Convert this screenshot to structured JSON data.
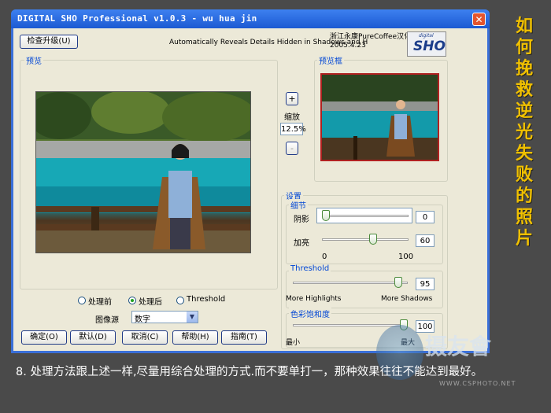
{
  "window": {
    "title": "DIGITAL SHO Professional  v1.0.3 - wu hua jin",
    "close_glyph": "✕",
    "subtitle": "Automatically Reveals Details Hidden in Shadows and H",
    "credit_line1": "浙江永康PureCoffee汉化",
    "credit_line2": "2005.4.23",
    "logo_small": "digital",
    "logo_big": "SHO"
  },
  "buttons": {
    "check_upgrade": "检查升级(U)",
    "zoom_in": "+",
    "zoom_out": "-",
    "ok": "确定(O)",
    "default": "默认(D)",
    "cancel": "取消(C)",
    "help": "帮助(H)",
    "guide": "指南(T)"
  },
  "preview": {
    "label": "预览",
    "zoom_label": "缩放",
    "zoom_value": "12.5%",
    "frame_label": "预览框"
  },
  "view_options": {
    "before": "处理前",
    "after": "处理后",
    "threshold": "Threshold",
    "selected": "after",
    "source_label": "图像源",
    "source_value": "数字"
  },
  "settings": {
    "label": "设置",
    "detail": {
      "label": "细节",
      "shadow_label": "阴影",
      "shadow_value": "0",
      "highlight_label": "加亮",
      "highlight_value": "60",
      "min_label": "0",
      "max_label": "100"
    },
    "threshold": {
      "label": "Threshold",
      "value": "95",
      "left_label": "More Highlights",
      "right_label": "More Shadows"
    },
    "saturation": {
      "label": "色彩饱和度",
      "value": "100",
      "min_label": "最小",
      "max_label": "最大"
    }
  },
  "side_title": [
    "如",
    "何",
    "挽",
    "救",
    "逆",
    "光",
    "失",
    "败",
    "的",
    "照",
    "片"
  ],
  "caption": "8. 处理方法跟上述一样,尽量用综合处理的方式.而不要单打一，那种效果往往不能达到最好。",
  "watermark": {
    "cn": "摄友會",
    "url": "WWW.CSPHOTO.NET"
  },
  "colors": {
    "title_bar": "#1c5ad2",
    "group_label": "#0046d5",
    "side_title": "#f0c000"
  }
}
